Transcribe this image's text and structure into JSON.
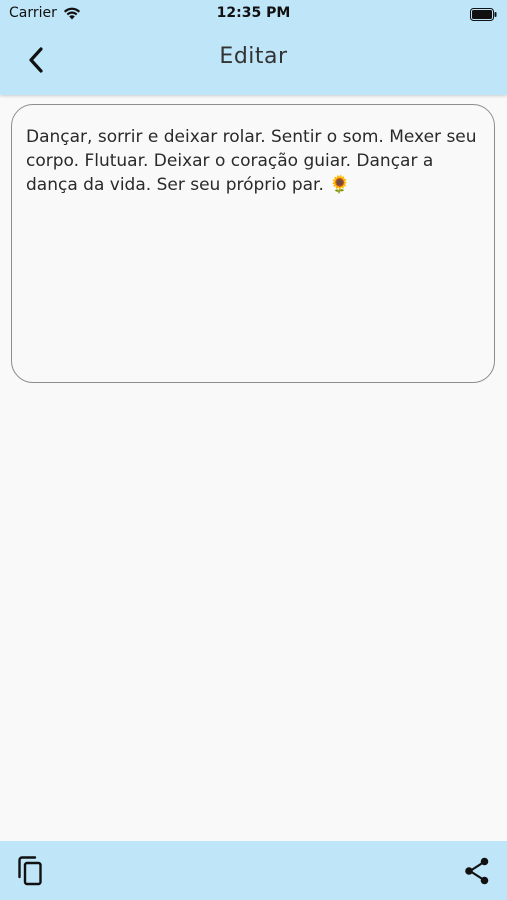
{
  "status_bar": {
    "carrier": "Carrier",
    "time": "12:35 PM"
  },
  "header": {
    "title": "Editar",
    "back_icon": "chevron-left-icon"
  },
  "editor": {
    "text": "Dançar, sorrir e deixar rolar. Sentir o som. Mexer seu corpo. Flutuar. Deixar o coração guiar. Dançar a dança da vida. Ser seu próprio par. 🌻"
  },
  "bottom_bar": {
    "copy_icon": "copy-icon",
    "share_icon": "share-icon"
  },
  "colors": {
    "bar_background": "#bfe5f8",
    "page_background": "#f9f9f9",
    "editor_border": "#8d8d8d"
  }
}
